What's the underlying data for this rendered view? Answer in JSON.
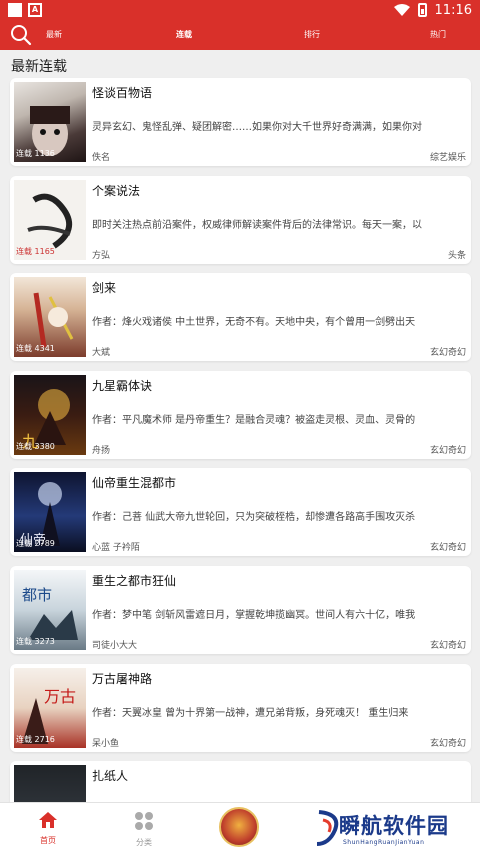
{
  "statusbar": {
    "icon_letter": "A",
    "time": "11:16"
  },
  "navbar": {
    "tabs": [
      {
        "label": "最新"
      },
      {
        "label": "连载"
      },
      {
        "label": "排行"
      },
      {
        "label": "热门"
      }
    ]
  },
  "section_title": "最新连载",
  "books": [
    {
      "title": "怪谈百物语",
      "tag": "连载 1136",
      "desc": "灵异玄幻、鬼怪乱弹、疑团解密……如果你对大千世界好奇满满，如果你对",
      "author": "佚名",
      "category": "综艺娱乐"
    },
    {
      "title": "个案说法",
      "tag": "连载 1165",
      "desc": "即时关注热点前沿案件，权威律师解读案件背后的法律常识。每天一案，以",
      "author": "方弘",
      "category": "头条"
    },
    {
      "title": "剑来",
      "tag": "连载 4341",
      "desc": "作者：烽火戏诸侯 中土世界，无奇不有。天地中央，有个曾用一剑劈出天",
      "author": "大斌",
      "category": "玄幻奇幻"
    },
    {
      "title": "九星霸体诀",
      "tag": "连载 3380",
      "desc": "作者：平凡魔术师 是丹帝重生？是融合灵魂？被盗走灵根、灵血、灵骨的",
      "author": "舟扬",
      "category": "玄幻奇幻"
    },
    {
      "title": "仙帝重生混都市",
      "tag": "连载 2789",
      "desc": "作者：己菩 仙武大帝九世轮回，只为突破桎梏，却惨遭各路高手围攻灭杀",
      "author": "心蓝 子衿陌",
      "category": "玄幻奇幻"
    },
    {
      "title": "重生之都市狂仙",
      "tag": "连载 3273",
      "desc": "作者：梦中笔 剑斩风雷遮日月，掌握乾坤揽幽冥。世间人有六十亿，唯我",
      "author": "司徒小大大",
      "category": "玄幻奇幻"
    },
    {
      "title": "万古屠神路",
      "tag": "连载 2716",
      "desc": "作者：天翼冰皇 曾为十界第一战神，遭兄弟背叛，身死魂灭！ 重生归来",
      "author": "呆小鱼",
      "category": "玄幻奇幻"
    },
    {
      "title": "扎纸人",
      "tag": "",
      "desc": "",
      "author": "",
      "category": ""
    }
  ],
  "bottom_nav": {
    "home_label": "首页",
    "category_label": "分类"
  },
  "watermark": {
    "text": "瞬航软件园",
    "sub": "ShunHangRuanJianYuan"
  },
  "colors": {
    "accent": "#d9302a",
    "watermark": "#1b3a8a"
  },
  "icons": [
    "search-icon",
    "wifi-icon",
    "battery-icon",
    "home-icon",
    "category-grid-icon"
  ]
}
